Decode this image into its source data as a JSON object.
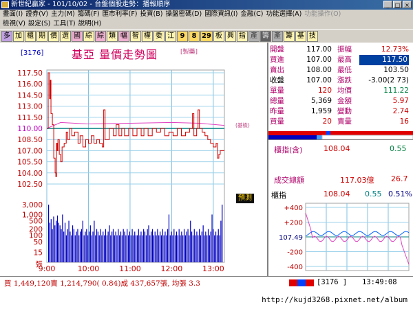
{
  "window": {
    "title": "新世紀贏家 - 101/10/02 - 台盤個股走勢：播報順序",
    "controls": [
      "_",
      "□",
      "×"
    ]
  },
  "menu": {
    "row1": [
      "畫面(I)",
      "證券(V)",
      "主力(M)",
      "籌碼(F)",
      "匯市利率(F)",
      "投資(B)",
      "操盤密碼(D)",
      "國際資訊(I)",
      "金融(C)",
      "功能選擇(A)",
      "功能操作(O)"
    ],
    "row1_disabled": [
      false,
      false,
      false,
      false,
      false,
      false,
      false,
      false,
      false,
      false,
      true
    ],
    "row2": [
      "檢視(V)",
      "設定(S)",
      "工具(T)",
      "說明(H)"
    ]
  },
  "toolbar": {
    "buttons": [
      {
        "label": "多",
        "style": "purple"
      },
      {
        "label": "加",
        "style": "yel"
      },
      {
        "label": "櫃",
        "style": "yel"
      },
      {
        "label": "期",
        "style": "yel"
      },
      {
        "label": "價",
        "style": "yel"
      },
      {
        "label": "選",
        "style": "yel"
      },
      {
        "label": "國",
        "style": "pink"
      },
      {
        "label": "綜",
        "style": "yel"
      },
      {
        "label": "綜",
        "style": "pink"
      },
      {
        "label": "類",
        "style": "yel"
      },
      {
        "label": "幅",
        "style": "pink"
      },
      {
        "label": "智",
        "style": "yel"
      },
      {
        "label": "權",
        "style": "yel"
      },
      {
        "label": "委",
        "style": "yel"
      },
      {
        "label": "江",
        "style": "yel"
      },
      {
        "label": "9",
        "style": "num"
      },
      {
        "label": "8",
        "style": "num"
      },
      {
        "label": "29",
        "style": "num"
      },
      {
        "label": "板",
        "style": "yel"
      },
      {
        "label": "興",
        "style": "yel"
      },
      {
        "label": "指",
        "style": "yel"
      },
      {
        "label": "產",
        "style": "gray"
      },
      {
        "label": "籌",
        "style": "dark"
      },
      {
        "label": "產",
        "style": "gray"
      },
      {
        "label": "籌",
        "style": "yel"
      },
      {
        "label": "基",
        "style": "yel"
      },
      {
        "label": "技",
        "style": "yel"
      }
    ]
  },
  "chart": {
    "code": "[3176]",
    "title": "基亞 量價走勢圖",
    "mode": "[製藥]",
    "ref_label": "(基檢)",
    "predict_badge": "預測"
  },
  "chart_data": {
    "type": "line",
    "price_ticks": [
      "117.50",
      "116.00",
      "114.50",
      "113.00",
      "111.50",
      "110.00",
      "108.50",
      "107.00",
      "105.50",
      "104.00",
      "102.50"
    ],
    "ylim": [
      102.5,
      117.5
    ],
    "reference_price": 110.0,
    "volume_ticks": [
      "3,000",
      "1,000",
      "500",
      "200",
      "100",
      "50",
      "15",
      "張"
    ],
    "x_ticks": [
      "9:00",
      "10:00",
      "11:00",
      "12:00",
      "13:00"
    ],
    "price_series": [
      {
        "t": 0,
        "v": 110.0
      },
      {
        "t": 2,
        "v": 117.5
      },
      {
        "t": 4,
        "v": 114.0
      },
      {
        "t": 5,
        "v": 116.5
      },
      {
        "t": 6,
        "v": 112.0
      },
      {
        "t": 8,
        "v": 110.5
      },
      {
        "t": 10,
        "v": 106.0
      },
      {
        "t": 12,
        "v": 104.0
      },
      {
        "t": 13,
        "v": 103.5
      },
      {
        "t": 14,
        "v": 108.0
      },
      {
        "t": 15,
        "v": 107.0
      },
      {
        "t": 16,
        "v": 108.5
      },
      {
        "t": 18,
        "v": 106.5
      },
      {
        "t": 20,
        "v": 105.5
      },
      {
        "t": 22,
        "v": 107.5
      },
      {
        "t": 25,
        "v": 108.0
      },
      {
        "t": 28,
        "v": 109.5
      },
      {
        "t": 30,
        "v": 108.5
      },
      {
        "t": 33,
        "v": 110.0
      },
      {
        "t": 36,
        "v": 109.0
      },
      {
        "t": 40,
        "v": 109.5
      },
      {
        "t": 45,
        "v": 108.0
      },
      {
        "t": 48,
        "v": 109.0
      },
      {
        "t": 52,
        "v": 107.5
      },
      {
        "t": 56,
        "v": 108.5
      },
      {
        "t": 60,
        "v": 108.0
      },
      {
        "t": 64,
        "v": 109.0
      },
      {
        "t": 68,
        "v": 108.0
      },
      {
        "t": 72,
        "v": 108.5
      },
      {
        "t": 76,
        "v": 108.0
      },
      {
        "t": 80,
        "v": 107.5
      },
      {
        "t": 82,
        "v": 112.5
      },
      {
        "t": 84,
        "v": 108.5
      },
      {
        "t": 90,
        "v": 110.0
      },
      {
        "t": 96,
        "v": 109.0
      },
      {
        "t": 100,
        "v": 110.5
      },
      {
        "t": 104,
        "v": 109.0
      },
      {
        "t": 108,
        "v": 110.0
      },
      {
        "t": 112,
        "v": 109.0
      },
      {
        "t": 118,
        "v": 110.0
      },
      {
        "t": 124,
        "v": 109.0
      },
      {
        "t": 130,
        "v": 110.0
      },
      {
        "t": 136,
        "v": 109.0
      },
      {
        "t": 140,
        "v": 110.0
      },
      {
        "t": 146,
        "v": 109.0
      },
      {
        "t": 152,
        "v": 110.0
      },
      {
        "t": 158,
        "v": 109.5
      },
      {
        "t": 164,
        "v": 110.0
      },
      {
        "t": 170,
        "v": 109.0
      },
      {
        "t": 176,
        "v": 109.5
      },
      {
        "t": 182,
        "v": 109.0
      },
      {
        "t": 188,
        "v": 110.0
      },
      {
        "t": 194,
        "v": 109.0
      },
      {
        "t": 200,
        "v": 109.5
      },
      {
        "t": 206,
        "v": 110.0
      },
      {
        "t": 210,
        "v": 112.0
      },
      {
        "t": 212,
        "v": 109.0
      },
      {
        "t": 216,
        "v": 110.0
      },
      {
        "t": 218,
        "v": 112.5
      },
      {
        "t": 220,
        "v": 110.0
      },
      {
        "t": 224,
        "v": 109.5
      },
      {
        "t": 228,
        "v": 109.0
      },
      {
        "t": 232,
        "v": 108.5
      },
      {
        "t": 236,
        "v": 108.0
      },
      {
        "t": 240,
        "v": 107.5
      },
      {
        "t": 244,
        "v": 108.0
      },
      {
        "t": 246,
        "v": 106.0
      },
      {
        "t": 248,
        "v": 106.5
      },
      {
        "t": 250,
        "v": 107.0
      },
      {
        "t": 256,
        "v": 107.0
      }
    ],
    "avg_series": [
      {
        "t": 0,
        "v": 110.0
      },
      {
        "t": 20,
        "v": 110.8
      },
      {
        "t": 60,
        "v": 110.6
      },
      {
        "t": 120,
        "v": 110.7
      },
      {
        "t": 180,
        "v": 110.8
      },
      {
        "t": 220,
        "v": 110.7
      },
      {
        "t": 256,
        "v": 110.4
      }
    ],
    "volume_series": [
      3000,
      400,
      600,
      200,
      800,
      300,
      500,
      900,
      400,
      300,
      200,
      1000,
      150,
      400,
      100,
      200,
      500,
      150,
      100,
      300,
      200,
      100,
      150,
      200,
      100,
      150,
      200,
      500,
      100,
      150,
      200,
      100,
      150,
      300,
      100,
      150,
      500,
      100,
      200,
      150,
      100,
      200,
      100,
      150,
      100,
      200,
      100,
      150,
      300,
      100,
      150,
      200,
      100,
      150,
      100,
      200,
      100,
      150,
      100,
      200,
      150,
      100,
      200,
      100,
      150,
      100,
      200,
      100,
      150,
      100,
      100,
      200,
      100,
      150,
      100,
      200,
      150,
      100,
      200,
      300,
      100,
      150,
      200,
      100,
      150,
      100,
      200,
      100,
      150,
      100,
      200,
      100,
      150,
      100,
      200,
      1000,
      100,
      150,
      100,
      200,
      100,
      150,
      100,
      200,
      100,
      150,
      100,
      200,
      100,
      150,
      200,
      100,
      500,
      150,
      100,
      200,
      100,
      150,
      100,
      200,
      100,
      150,
      300,
      100,
      150,
      100,
      200,
      100,
      150,
      1000,
      200,
      100,
      150,
      100,
      200,
      100,
      500,
      3000
    ]
  },
  "quote": {
    "rows": [
      {
        "l1": "開盤",
        "v1": "117.00",
        "l2": "振幅",
        "v2": "12.73%",
        "v2style": "red"
      },
      {
        "l1": "買進",
        "v1": "107.00",
        "l2": "最高",
        "v2": "117.50",
        "v2style": "highlight"
      },
      {
        "l1": "賣出",
        "v1": "108.00",
        "l2": "最低",
        "v2": "103.50",
        "v2style": "black"
      },
      {
        "l1": "收盤",
        "v1": "107.00",
        "l2": "漲跌",
        "v2": "-3.00(2 73)",
        "v2style": "black",
        "l1black": true
      },
      {
        "l1": "單量",
        "v1": "120",
        "l2": "均價",
        "v2": "111.22",
        "v2style": "green",
        "v1red": true
      },
      {
        "l1": "總量",
        "v1": "5,369",
        "l2": "金額",
        "v2": "5.97",
        "v2style": "red"
      },
      {
        "l1": "昨量",
        "v1": "1,959",
        "l2": "變動",
        "v2": "2.74",
        "v2style": "red"
      },
      {
        "l1": "買量",
        "v1": "20",
        "l2": "賣量",
        "v2": "16",
        "v2style": "red",
        "v1red": true
      }
    ]
  },
  "index_summary": {
    "label": "櫃指(含)",
    "value": "108.04",
    "change": "0.55"
  },
  "volume_summary": {
    "label": "成交總額",
    "value": "117.03億",
    "change": "26.7"
  },
  "mini_index": {
    "label": "櫃指",
    "value": "108.04",
    "change": "0.55",
    "pct": "0.51%",
    "ticks": [
      "+400",
      "+200",
      "107.49",
      "-200",
      "-400"
    ]
  },
  "status": {
    "summary": "買 1,449,120賣 1,214,790( 0.84)成 437,657張, 均張 3.3",
    "code": "[3176     ]",
    "time": "13:49:08",
    "colors": [
      "#e00000",
      "#0040ff",
      "#e00000"
    ]
  },
  "url": "http://kujd3268.pixnet.net/album"
}
